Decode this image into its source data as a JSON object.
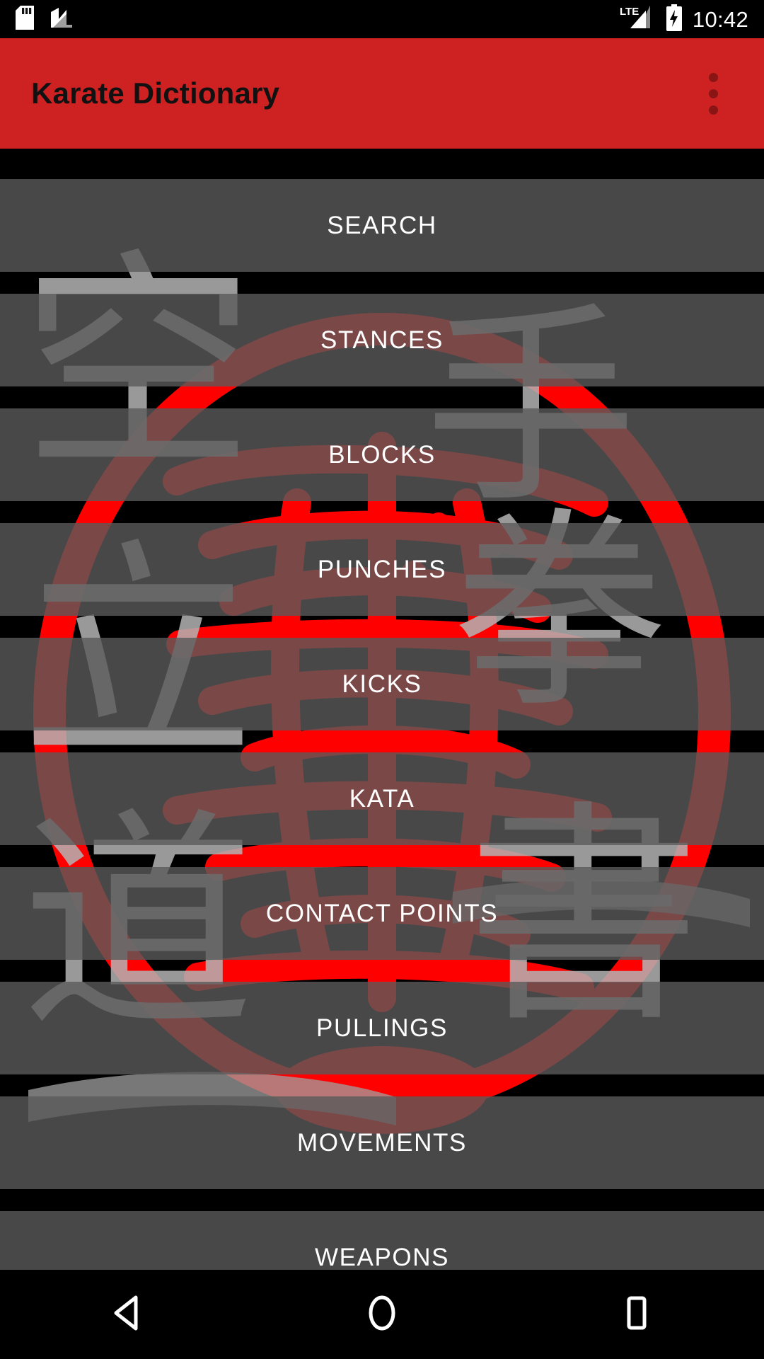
{
  "status_bar": {
    "icons_left": [
      "sd-card-icon",
      "android-nougat-icon"
    ],
    "icons_right": [
      "lte-signal-icon",
      "battery-charging-icon"
    ],
    "network_label": "LTE",
    "time": "10:42"
  },
  "app_bar": {
    "title": "Karate Dictionary",
    "overflow_icon": "overflow-menu-icon",
    "background_color": "#cd2122",
    "title_color": "#111111"
  },
  "menu": {
    "items": [
      {
        "label": "SEARCH"
      },
      {
        "label": "STANCES"
      },
      {
        "label": "BLOCKS"
      },
      {
        "label": "PUNCHES"
      },
      {
        "label": "KICKS"
      },
      {
        "label": "KATA"
      },
      {
        "label": "CONTACT POINTS"
      },
      {
        "label": "PULLINGS"
      },
      {
        "label": "MOVEMENTS"
      },
      {
        "label": "WEAPONS"
      }
    ],
    "button_fill": "rgba(90,90,90,0.80)",
    "label_color": "#ffffff"
  },
  "background": {
    "description": "karate kanji calligraphy watermark with red circular brush seal",
    "seal_color": "#ff0000",
    "kanji_color": "#b4b4b4",
    "kanji_glyphs": [
      "空",
      "手",
      "道",
      "書",
      "拳"
    ]
  },
  "nav_bar": {
    "buttons": [
      {
        "name": "back-button",
        "icon": "back-triangle-icon"
      },
      {
        "name": "home-button",
        "icon": "home-circle-icon"
      },
      {
        "name": "recents-button",
        "icon": "recents-square-icon"
      }
    ]
  }
}
